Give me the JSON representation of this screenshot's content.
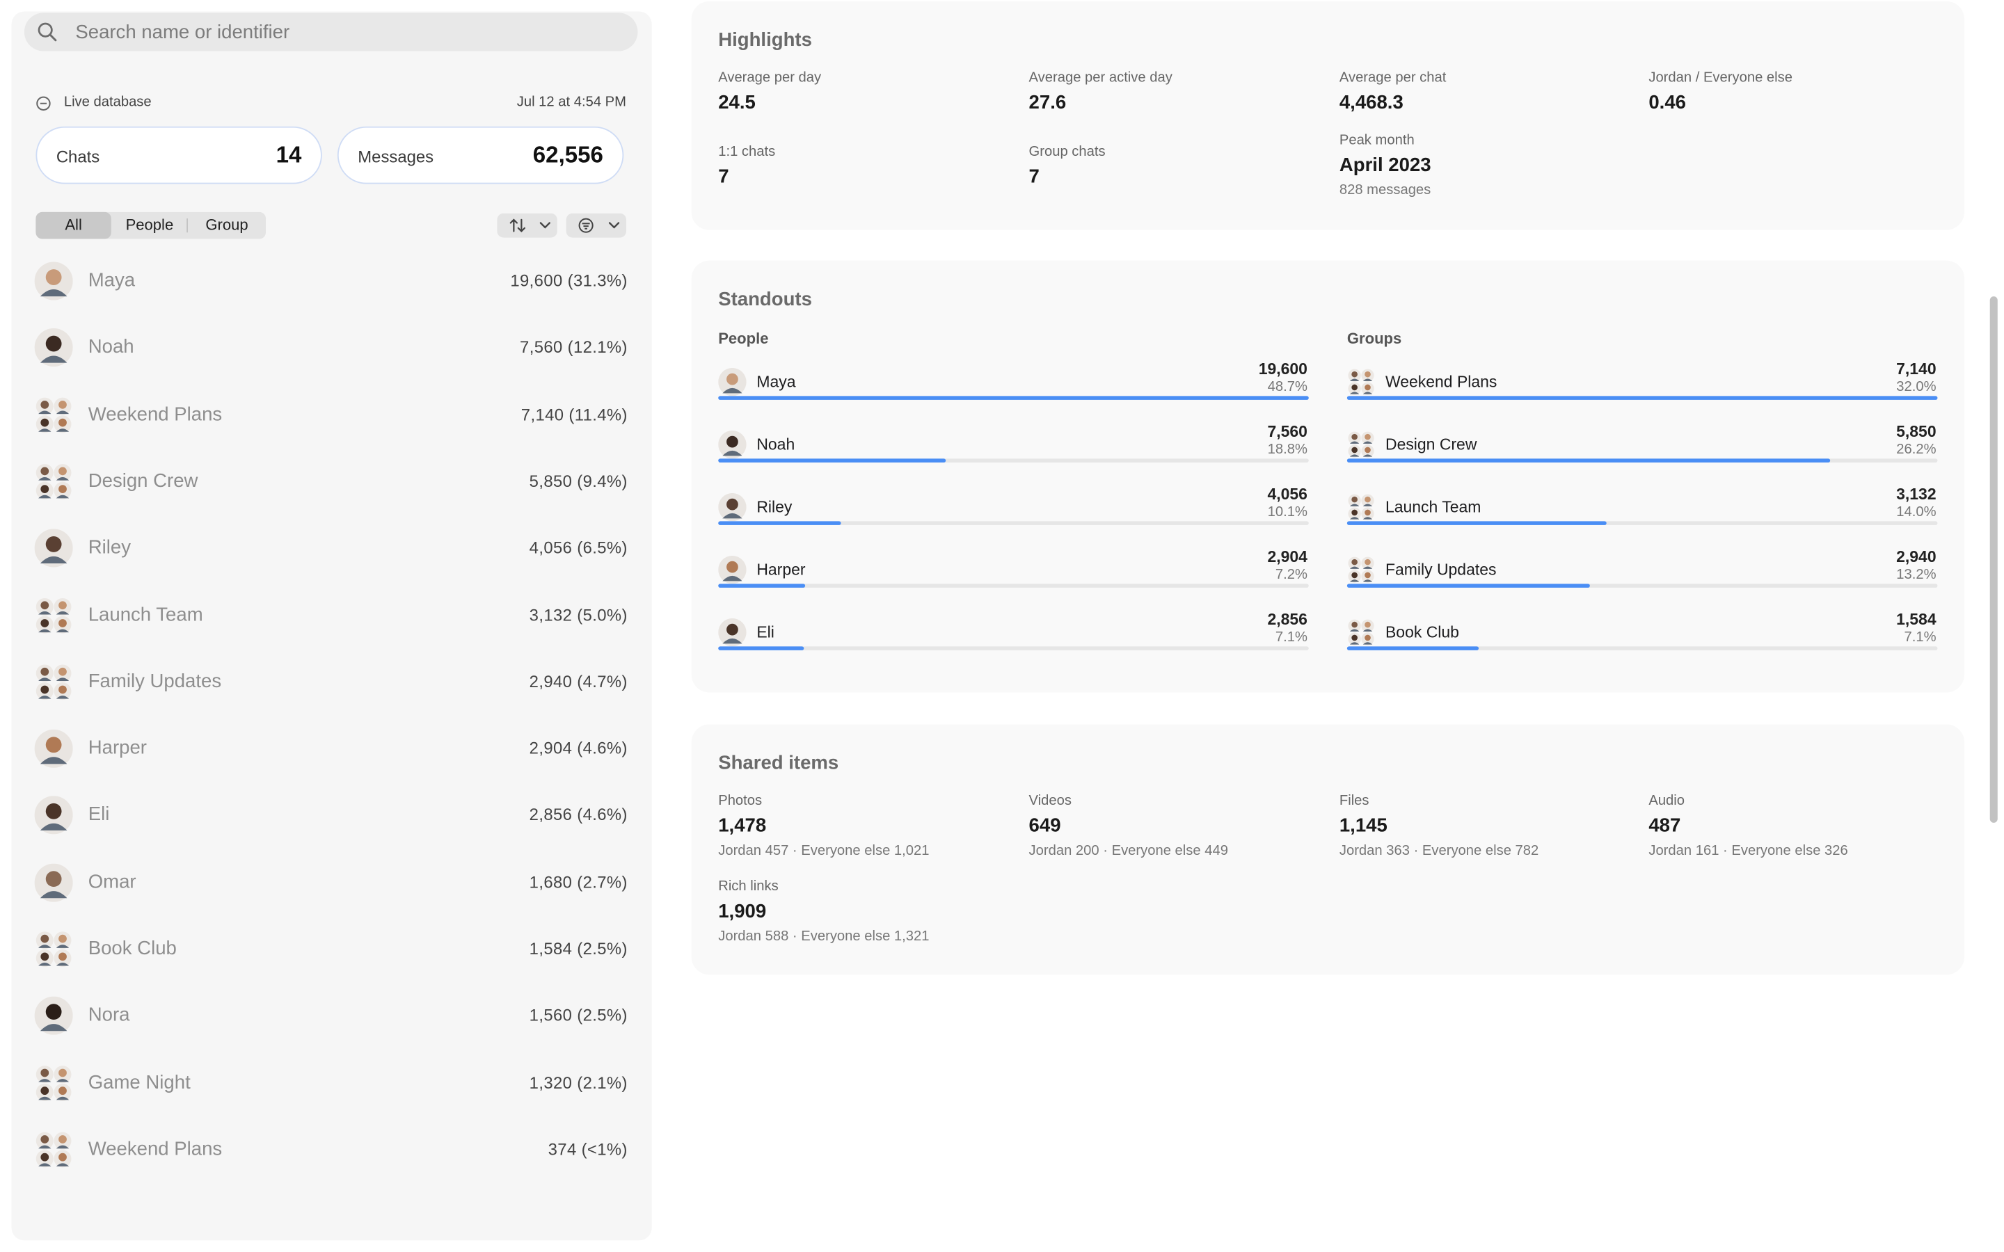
{
  "search": {
    "placeholder": "Search name or identifier"
  },
  "status": {
    "label": "Live database",
    "timestamp": "Jul 12 at 4:54 PM"
  },
  "totals": {
    "chats_label": "Chats",
    "chats_value": "14",
    "messages_label": "Messages",
    "messages_value": "62,556"
  },
  "filters": {
    "all": "All",
    "people": "People",
    "group": "Group"
  },
  "conversations": [
    {
      "name": "Maya",
      "value": "19,600 (31.3%)",
      "avatar": "single",
      "tone": "#c89b7a"
    },
    {
      "name": "Noah",
      "value": "7,560 (12.1%)",
      "avatar": "single",
      "tone": "#3b2a22"
    },
    {
      "name": "Weekend Plans",
      "value": "7,140 (11.4%)",
      "avatar": "group"
    },
    {
      "name": "Design Crew",
      "value": "5,850 (9.4%)",
      "avatar": "group"
    },
    {
      "name": "Riley",
      "value": "4,056 (6.5%)",
      "avatar": "single",
      "tone": "#5a4033"
    },
    {
      "name": "Launch Team",
      "value": "3,132 (5.0%)",
      "avatar": "group"
    },
    {
      "name": "Family Updates",
      "value": "2,940 (4.7%)",
      "avatar": "group"
    },
    {
      "name": "Harper",
      "value": "2,904 (4.6%)",
      "avatar": "single",
      "tone": "#b07a55"
    },
    {
      "name": "Eli",
      "value": "2,856 (4.6%)",
      "avatar": "single",
      "tone": "#4a3428"
    },
    {
      "name": "Omar",
      "value": "1,680 (2.7%)",
      "avatar": "single",
      "tone": "#8a6a55"
    },
    {
      "name": "Book Club",
      "value": "1,584 (2.5%)",
      "avatar": "group"
    },
    {
      "name": "Nora",
      "value": "1,560 (2.5%)",
      "avatar": "single",
      "tone": "#2a1e18"
    },
    {
      "name": "Game Night",
      "value": "1,320 (2.1%)",
      "avatar": "group"
    },
    {
      "name": "Weekend Plans",
      "value": "374 (<1%)",
      "avatar": "group"
    }
  ],
  "highlights": {
    "title": "Highlights",
    "stats": [
      {
        "label": "Average per day",
        "value": "24.5"
      },
      {
        "label": "Average per active day",
        "value": "27.6"
      },
      {
        "label": "Average per chat",
        "value": "4,468.3"
      },
      {
        "label": "Jordan / Everyone else",
        "value": "0.46"
      },
      {
        "label": "1:1 chats",
        "value": "7"
      },
      {
        "label": "Group chats",
        "value": "7"
      },
      {
        "label": "Peak month",
        "value": "April 2023",
        "sub": "828 messages"
      }
    ]
  },
  "standouts": {
    "title": "Standouts",
    "people_label": "People",
    "groups_label": "Groups",
    "people": [
      {
        "name": "Maya",
        "value": "19,600",
        "pct": "48.7%",
        "fraction": 1.0,
        "tone": "#c89b7a"
      },
      {
        "name": "Noah",
        "value": "7,560",
        "pct": "18.8%",
        "fraction": 0.386,
        "tone": "#3b2a22"
      },
      {
        "name": "Riley",
        "value": "4,056",
        "pct": "10.1%",
        "fraction": 0.207,
        "tone": "#5a4033"
      },
      {
        "name": "Harper",
        "value": "2,904",
        "pct": "7.2%",
        "fraction": 0.148,
        "tone": "#b07a55"
      },
      {
        "name": "Eli",
        "value": "2,856",
        "pct": "7.1%",
        "fraction": 0.146,
        "tone": "#4a3428"
      }
    ],
    "groups": [
      {
        "name": "Weekend Plans",
        "value": "7,140",
        "pct": "32.0%",
        "fraction": 1.0
      },
      {
        "name": "Design Crew",
        "value": "5,850",
        "pct": "26.2%",
        "fraction": 0.819
      },
      {
        "name": "Launch Team",
        "value": "3,132",
        "pct": "14.0%",
        "fraction": 0.439
      },
      {
        "name": "Family Updates",
        "value": "2,940",
        "pct": "13.2%",
        "fraction": 0.412
      },
      {
        "name": "Book Club",
        "value": "1,584",
        "pct": "7.1%",
        "fraction": 0.222
      }
    ]
  },
  "shared": {
    "title": "Shared items",
    "items": [
      {
        "label": "Photos",
        "value": "1,478",
        "sub": "Jordan 457 · Everyone else 1,021"
      },
      {
        "label": "Videos",
        "value": "649",
        "sub": "Jordan 200 · Everyone else 449"
      },
      {
        "label": "Files",
        "value": "1,145",
        "sub": "Jordan 363 · Everyone else 782"
      },
      {
        "label": "Audio",
        "value": "487",
        "sub": "Jordan 161 · Everyone else 326"
      },
      {
        "label": "Rich links",
        "value": "1,909",
        "sub": "Jordan 588 · Everyone else 1,321"
      }
    ]
  },
  "colors": {
    "accent": "#4a8ef5",
    "pill_border": "#cfdcf5",
    "card_bg": "#f9f9f9"
  },
  "icons": {
    "search": "search-icon",
    "live": "database-icon",
    "sort": "sort-icon",
    "filter": "filter-icon",
    "chevron": "chevron-down-icon"
  }
}
